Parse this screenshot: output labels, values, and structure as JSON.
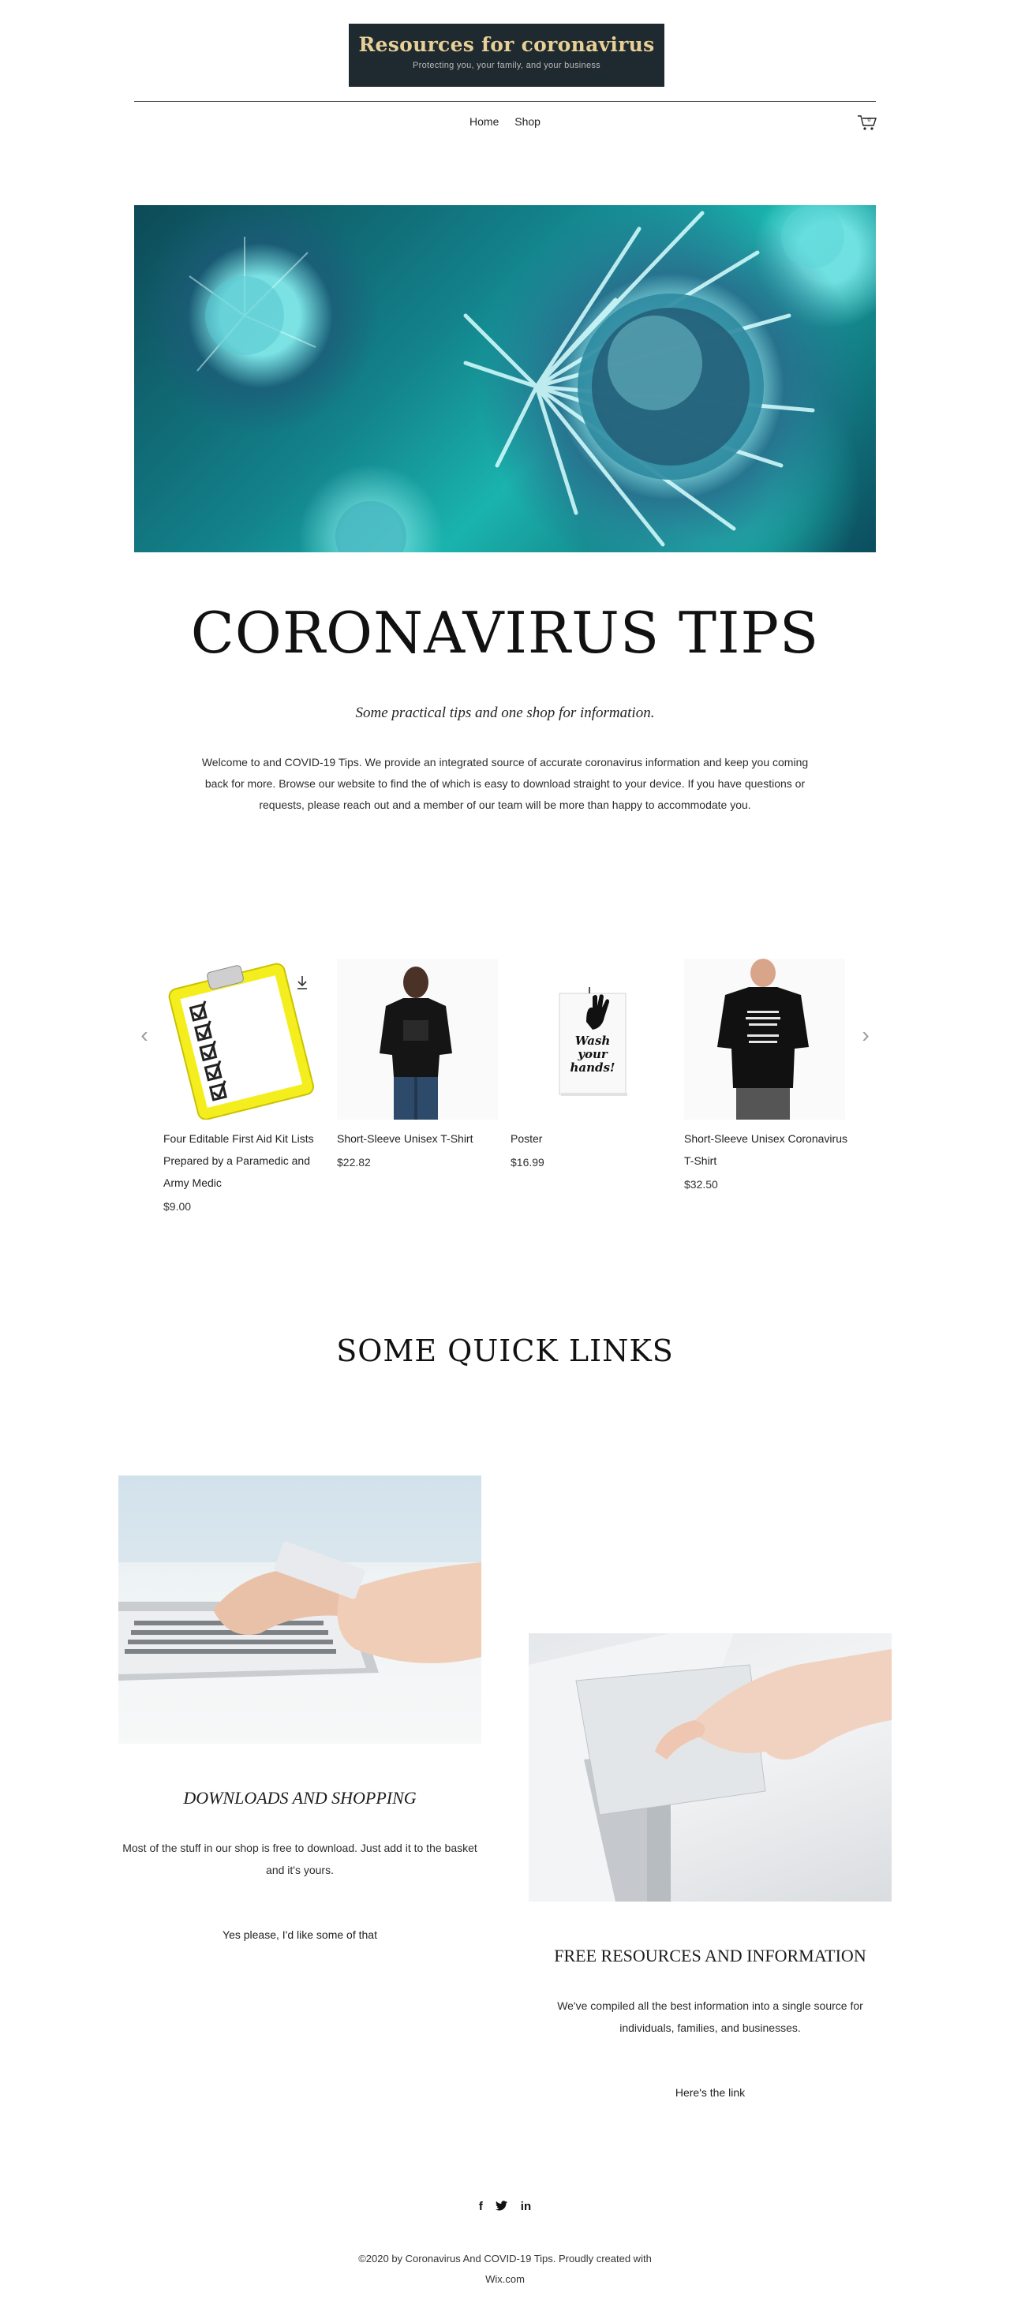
{
  "header": {
    "logo_title": "Resources for coronavirus",
    "logo_subtitle": "Protecting you, your family, and your business",
    "nav": [
      "Home",
      "Shop"
    ],
    "cart_count": "0"
  },
  "hero": {
    "title": "CORONAVIRUS TIPS",
    "subtitle": "Some practical tips and one shop for information.",
    "intro": "Welcome to and COVID-19 Tips. We provide an integrated source of accurate coronavirus information and keep you coming back for more. Browse our website to find the of which is easy to download straight to your device. If you have questions or requests, please reach out and a member of our team will be more than happy to accommodate you."
  },
  "slider": {
    "prev": "‹",
    "next": "›",
    "products": [
      {
        "name": "Four Editable First Aid Kit Lists Prepared by a Paramedic and Army Medic",
        "price": "$9.00"
      },
      {
        "name": "Short-Sleeve Unisex T-Shirt",
        "price": "$22.82"
      },
      {
        "name": "Poster",
        "price": "$16.99",
        "poster_text": "Wash your hands!"
      },
      {
        "name": "Short-Sleeve Unisex Coronavirus T-Shirt",
        "price": "$32.50"
      }
    ]
  },
  "quick_links": {
    "title": "SOME QUICK LINKS",
    "items": [
      {
        "title": "DOWNLOADS AND SHOPPING",
        "description": "Most of the stuff in our shop is free to download. Just add it to the basket and it's yours.",
        "link": "Yes please, I'd like some of that"
      },
      {
        "title": "FREE RESOURCES AND INFORMATION",
        "description": "We've compiled all the best information into a single source for individuals, families, and businesses.",
        "link": "Here's the link"
      }
    ]
  },
  "footer": {
    "social": [
      "f",
      "t",
      "in"
    ],
    "copyright": "©2020 by Coronavirus And COVID-19 Tips. Proudly created with Wix.com"
  },
  "colors": {
    "logo_bg": "#1f2a30",
    "logo_gold": "#e7cf95",
    "hero_teal": "#13838c",
    "clipboard_yellow": "#f5ee1f"
  }
}
